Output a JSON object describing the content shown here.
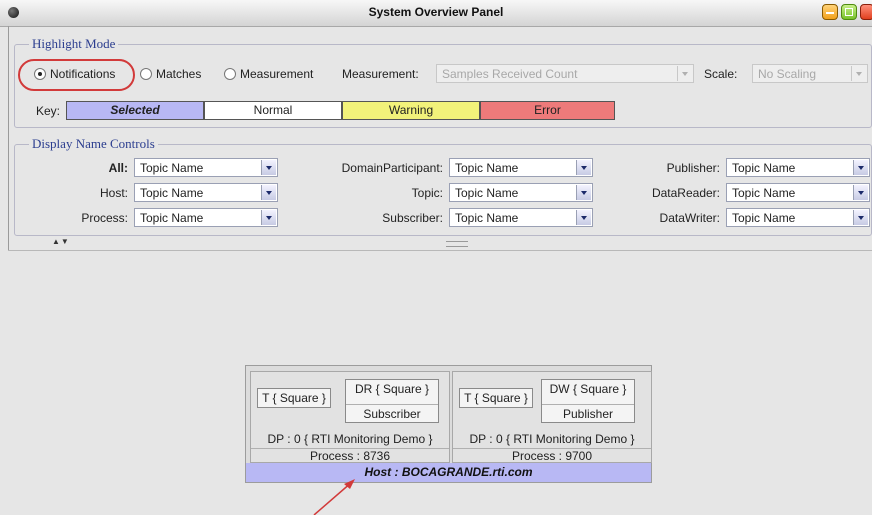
{
  "window": {
    "title": "System Overview Panel"
  },
  "highlight_mode": {
    "section_title": "Highlight Mode",
    "radios": [
      {
        "label": "Notifications",
        "checked": true
      },
      {
        "label": "Matches",
        "checked": false
      },
      {
        "label": "Measurement",
        "checked": false
      }
    ],
    "measurement_label": "Measurement:",
    "measurement_value": "Samples Received Count",
    "scale_label": "Scale:",
    "scale_value": "No Scaling",
    "key_label": "Key:",
    "key_items": [
      {
        "label": "Selected",
        "color": "#b8b8f4"
      },
      {
        "label": "Normal",
        "color": "#ffffff"
      },
      {
        "label": "Warning",
        "color": "#f2f27a"
      },
      {
        "label": "Error",
        "color": "#ee7a7a"
      }
    ]
  },
  "display_name_controls": {
    "section_title": "Display Name Controls",
    "col1": [
      {
        "label": "All:",
        "value": "Topic Name"
      },
      {
        "label": "Host:",
        "value": "Topic Name"
      },
      {
        "label": "Process:",
        "value": "Topic Name"
      }
    ],
    "col2": [
      {
        "label": "DomainParticipant:",
        "value": "Topic Name"
      },
      {
        "label": "Topic:",
        "value": "Topic Name"
      },
      {
        "label": "Subscriber:",
        "value": "Topic Name"
      }
    ],
    "col3": [
      {
        "label": "Publisher:",
        "value": "Topic Name"
      },
      {
        "label": "DataReader:",
        "value": "Topic Name"
      },
      {
        "label": "DataWriter:",
        "value": "Topic Name"
      }
    ]
  },
  "diagram": {
    "host_label": "Host : BOCAGRANDE.rti.com",
    "processes": [
      {
        "topic": "T { Square }",
        "entity_line1": "DR { Square }",
        "entity_line2": "Subscriber",
        "participant": "DP : 0 { RTI Monitoring Demo }",
        "process": "Process : 8736"
      },
      {
        "topic": "T { Square }",
        "entity_line1": "DW { Square }",
        "entity_line2": "Publisher",
        "participant": "DP : 0 { RTI Monitoring Demo }",
        "process": "Process : 9700"
      }
    ]
  }
}
